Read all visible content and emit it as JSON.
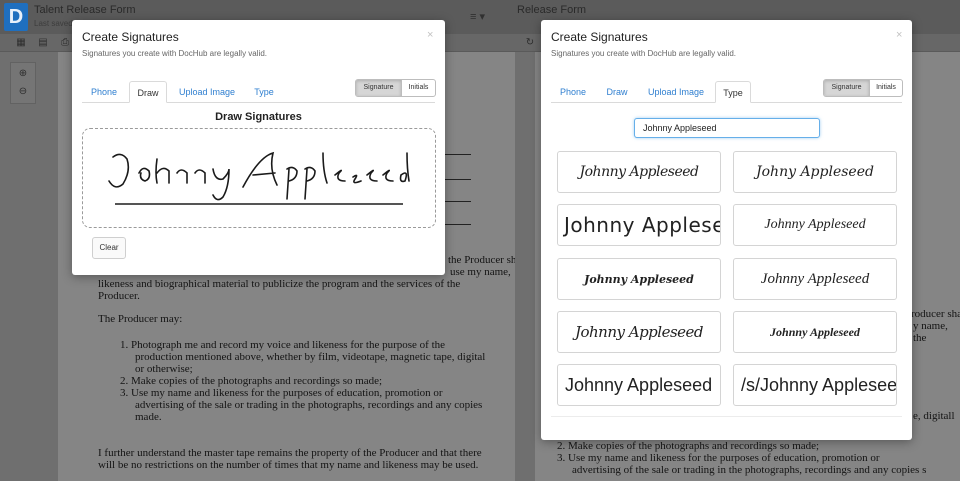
{
  "app": {
    "logo_letter": "D",
    "doc_title": "Talent Release Form",
    "doc_title_right": "Release Form",
    "doc_subtitle": "Last saved",
    "brand_color": "#1f6fbf"
  },
  "toolbar": {
    "icons": [
      "grid-icon",
      "table-icon",
      "print-icon"
    ],
    "right_icons": [
      "redo-icon"
    ],
    "zoom_icons": [
      "zoom-in-icon",
      "zoom-out-icon"
    ]
  },
  "document": {
    "left_lines": [
      "the Producer sh",
      "use my name,",
      "likeness and biographical material to publicize the program and the services of the",
      "Producer.",
      "The Producer may:",
      "1.  Photograph me and record my voice and likeness for the purpose of the",
      "production mentioned above, whether by film, videotape, magnetic tape, digital",
      "or otherwise;",
      "2.  Make copies of the photographs and recordings so made;",
      "3.  Use my name and likeness for the purposes of education, promotion or",
      "advertising of the sale or trading in the photographs, recordings and any copies",
      "made.",
      "I further understand the master tape remains the property of the Producer and that there",
      "will be no restrictions on the number of times that my name and likeness may be used."
    ],
    "right_lines": [
      "roducer sha",
      "y name,",
      "the",
      "e, digitall",
      "2.  Make copies of the photographs and recordings so made;",
      "3.  Use my name and likeness for the purposes of education, promotion or",
      "advertising of the sale or trading in the photographs, recordings and any copies s"
    ]
  },
  "modal_left": {
    "title": "Create Signatures",
    "subtitle": "Signatures you create with DocHub are legally valid.",
    "close": "×",
    "tabs": [
      "Phone",
      "Draw",
      "Upload Image",
      "Type"
    ],
    "active_tab": "Draw",
    "toggle": [
      "Signature",
      "Initials"
    ],
    "toggle_selected": "Signature",
    "draw_heading": "Draw Signatures",
    "drawn_signature": "Johnny Appleseed",
    "clear_label": "Clear"
  },
  "modal_right": {
    "title": "Create Signatures",
    "subtitle": "Signatures you create with DocHub are legally valid.",
    "close": "×",
    "tabs": [
      "Phone",
      "Draw",
      "Upload Image",
      "Type"
    ],
    "active_tab": "Type",
    "toggle": [
      "Signature",
      "Initials"
    ],
    "toggle_selected": "Signature",
    "typed_name": "Johnny Appleseed",
    "signature_options": [
      "Johnny Appleseed",
      "Johny Appleseed",
      "Johnny Appleseed",
      "Johnny Appleseed",
      "Johnny Appleseed",
      "Johnny Appleseed",
      "Johnny Appleseed",
      "Johnny Appleseed",
      "Johnny Appleseed",
      "/s/Johnny Appleseed"
    ]
  }
}
